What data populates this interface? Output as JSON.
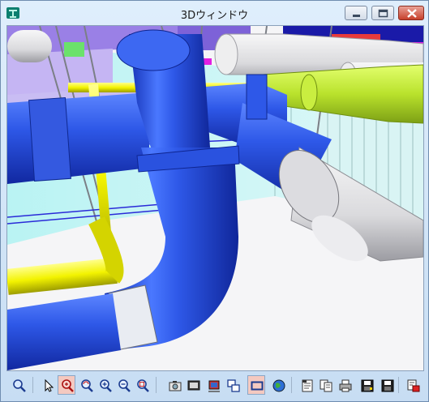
{
  "window": {
    "title": "3Dウィンドウ",
    "controls": [
      {
        "name": "minimize-button",
        "icon": "minimize-icon"
      },
      {
        "name": "maximize-button",
        "icon": "maximize-icon"
      },
      {
        "name": "close-button",
        "icon": "close-icon"
      }
    ]
  },
  "colors": {
    "pipe_blue": "#2e58e8",
    "pipe_yellow": "#f3f300",
    "pipe_lime": "#b9e22c",
    "pipe_white": "#e8e8ea",
    "duct_purple": "#9a80e6",
    "toolbar_active": "#f4c9c0",
    "close_red": "#c7402b"
  },
  "toolbar": {
    "tools": [
      {
        "name": "zoom-window-button",
        "icon": "magnifier-icon"
      },
      {
        "name": "select-button",
        "icon": "pointer-arrow-icon"
      },
      {
        "name": "zoom-realtime-button",
        "icon": "magnifier-pan-icon",
        "active": true
      },
      {
        "name": "rotate-view-button",
        "icon": "magnifier-rotate-icon"
      },
      {
        "name": "zoom-in-button",
        "icon": "magnifier-plus-icon"
      },
      {
        "name": "zoom-out-button",
        "icon": "magnifier-minus-icon"
      },
      {
        "name": "zoom-fit-button",
        "icon": "magnifier-fit-icon"
      },
      {
        "name": "camera-button",
        "icon": "camera-icon"
      },
      {
        "name": "display-mode-button",
        "icon": "screen-icon"
      },
      {
        "name": "render-button",
        "icon": "render-box-icon"
      },
      {
        "name": "copy-view-button",
        "icon": "overlap-windows-icon"
      },
      {
        "name": "frame-button",
        "icon": "rectangle-icon",
        "active": true
      },
      {
        "name": "globe-button",
        "icon": "globe-icon"
      },
      {
        "name": "properties-button",
        "icon": "properties-icon"
      },
      {
        "name": "copy-button",
        "icon": "copy-icon"
      },
      {
        "name": "print-button",
        "icon": "printer-icon"
      },
      {
        "name": "save-image-button",
        "icon": "save-image-icon"
      },
      {
        "name": "save-button",
        "icon": "floppy-disk-icon"
      },
      {
        "name": "export-button",
        "icon": "export-icon"
      }
    ]
  }
}
